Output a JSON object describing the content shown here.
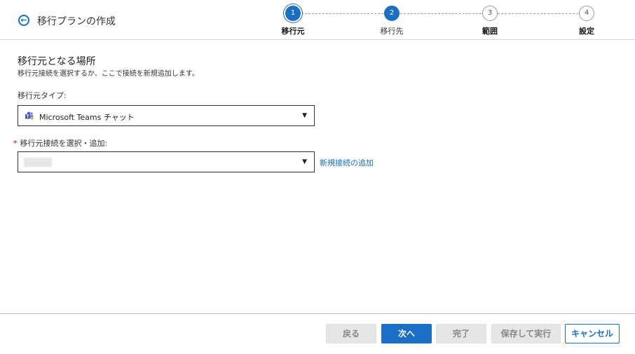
{
  "header": {
    "title": "移行プランの作成",
    "back_icon": "arrow-left-circle-icon"
  },
  "steps": [
    {
      "number": "1",
      "label": "移行元",
      "state": "done"
    },
    {
      "number": "2",
      "label": "移行先",
      "state": "active"
    },
    {
      "number": "3",
      "label": "範囲",
      "state": "todo"
    },
    {
      "number": "4",
      "label": "設定",
      "state": "todo"
    }
  ],
  "section": {
    "title": "移行元となる場所",
    "description": "移行元接続を選択するか、ここで接続を新規追加します。"
  },
  "source_type": {
    "label": "移行元タイプ:",
    "value": "Microsoft Teams チャット",
    "icon": "microsoft-teams-icon"
  },
  "connection": {
    "required_mark": "*",
    "label": "移行元接続を選択・追加:",
    "value": "",
    "add_link": "新規接続の追加"
  },
  "footer": {
    "back": "戻る",
    "next": "次へ",
    "finish": "完了",
    "save_run": "保存して実行",
    "cancel": "キャンセル"
  },
  "colors": {
    "accent": "#1a6fc4",
    "required": "#dd0000",
    "disabled_bg": "#e6e6e6"
  }
}
